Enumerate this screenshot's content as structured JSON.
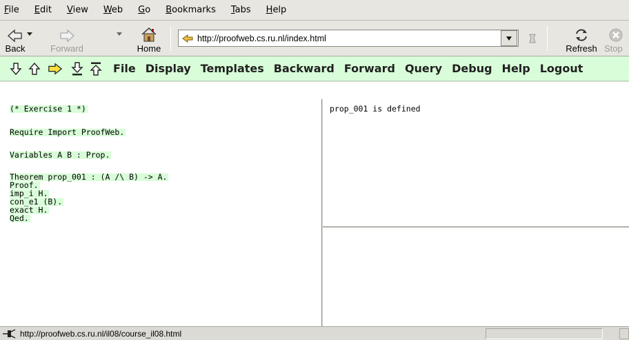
{
  "menubar": {
    "items": [
      {
        "label": "File",
        "mnemonic": "F",
        "rest": "ile"
      },
      {
        "label": "Edit",
        "mnemonic": "E",
        "rest": "dit"
      },
      {
        "label": "View",
        "mnemonic": "V",
        "rest": "iew"
      },
      {
        "label": "Web",
        "mnemonic": "W",
        "rest": "eb"
      },
      {
        "label": "Go",
        "mnemonic": "G",
        "rest": "o"
      },
      {
        "label": "Bookmarks",
        "mnemonic": "B",
        "rest": "ookmarks"
      },
      {
        "label": "Tabs",
        "mnemonic": "T",
        "rest": "abs"
      },
      {
        "label": "Help",
        "mnemonic": "H",
        "rest": "elp"
      }
    ]
  },
  "navbar": {
    "back_label": "Back",
    "forward_label": "Forward",
    "home_label": "Home",
    "refresh_label": "Refresh",
    "stop_label": "Stop",
    "url": "http://proofweb.cs.ru.nl/index.html"
  },
  "proofweb_bar": {
    "icons": [
      "arrow-down-icon",
      "arrow-up-icon",
      "arrow-right-double-icon",
      "arrow-down-to-bottom-icon",
      "arrow-up-to-top-icon"
    ],
    "menus": [
      "File",
      "Display",
      "Templates",
      "Backward",
      "Forward",
      "Query",
      "Debug",
      "Help",
      "Logout"
    ],
    "accent": "#d8fdd8"
  },
  "editor": {
    "lines": [
      "(* Exercise 1 *)",
      "Require Import ProofWeb.",
      "Variables A B : Prop.",
      "Theorem prop_001 : (A /\\ B) -> A.",
      "Proof.",
      "imp_i H.",
      "con_e1 (B).",
      "exact H.",
      "Qed."
    ]
  },
  "response": {
    "text": "prop_001 is defined"
  },
  "statusbar": {
    "text": "http://proofweb.cs.ru.nl/il08/course_il08.html"
  }
}
